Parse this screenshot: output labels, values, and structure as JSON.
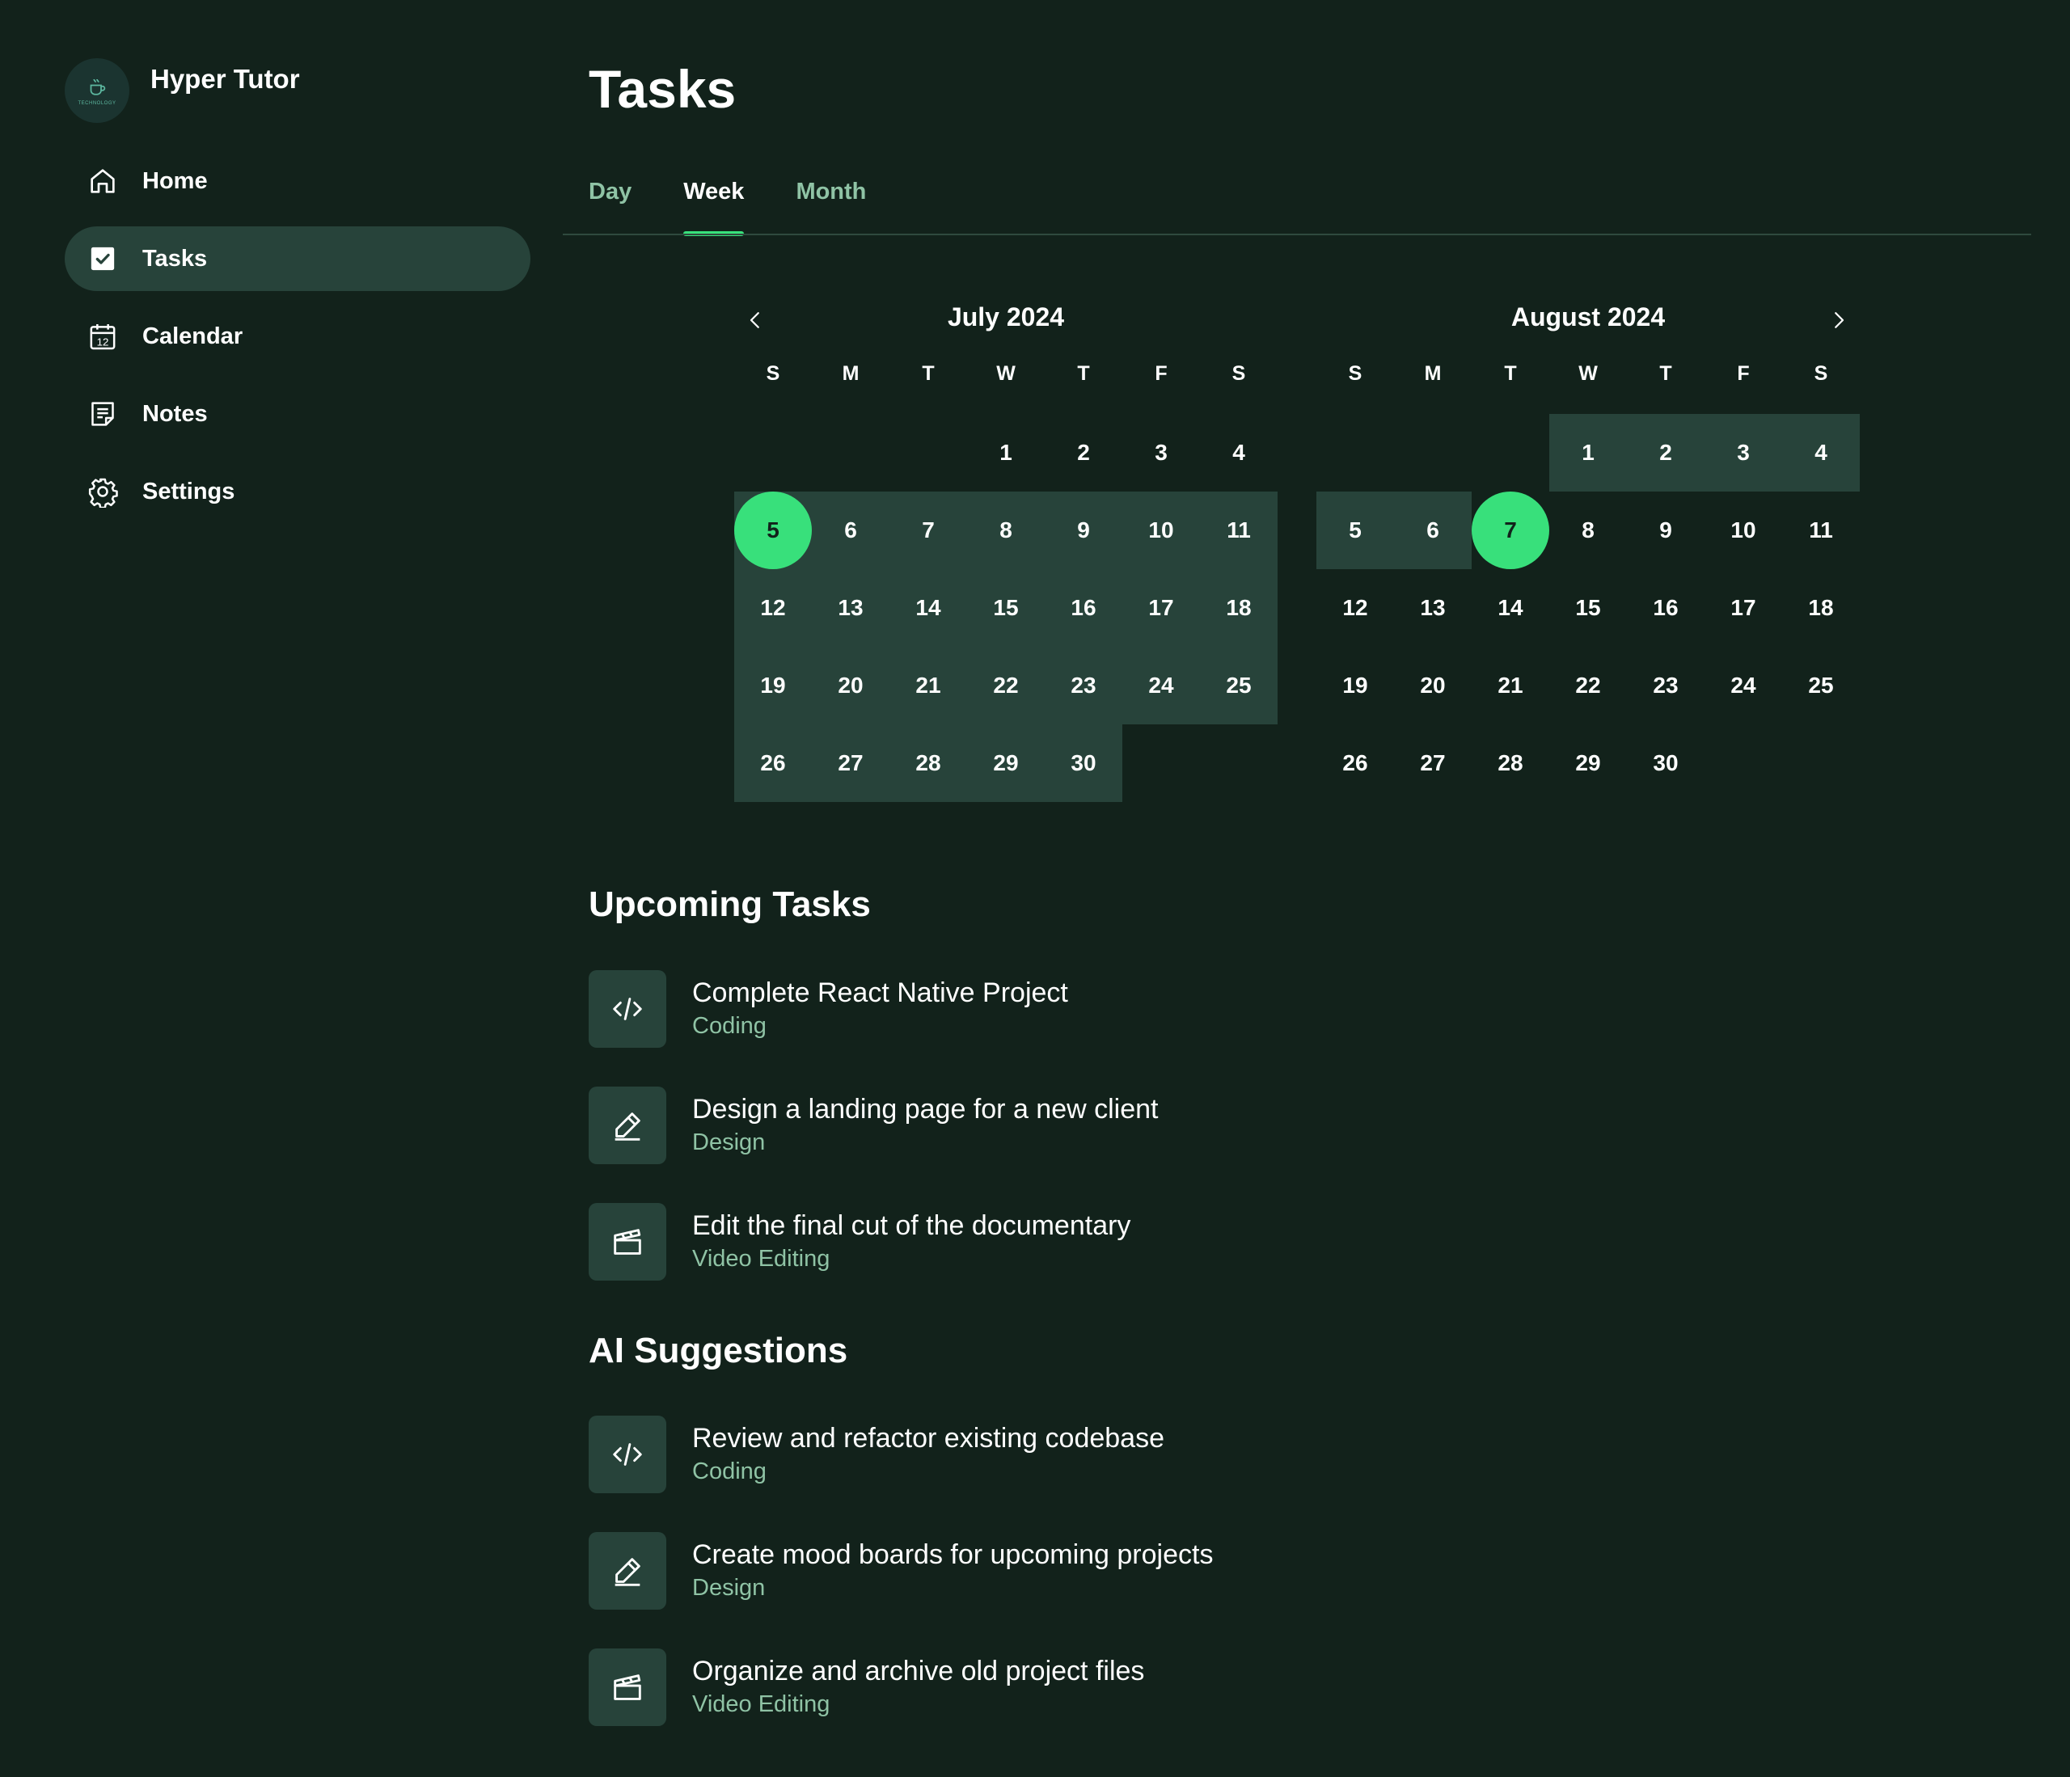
{
  "app": {
    "name": "Hyper Tutor",
    "logo_icon": "coffee-cup-logo",
    "logo_text": "TECHNOLOGY"
  },
  "sidebar": {
    "items": [
      {
        "label": "Home",
        "icon": "home-icon",
        "active": false
      },
      {
        "label": "Tasks",
        "icon": "checkbox-icon",
        "active": true
      },
      {
        "label": "Calendar",
        "icon": "calendar-icon",
        "active": false,
        "icon_text": "12"
      },
      {
        "label": "Notes",
        "icon": "notes-icon",
        "active": false
      },
      {
        "label": "Settings",
        "icon": "gear-icon",
        "active": false
      }
    ]
  },
  "page": {
    "title": "Tasks"
  },
  "tabs": [
    {
      "label": "Day",
      "active": false
    },
    {
      "label": "Week",
      "active": true
    },
    {
      "label": "Month",
      "active": false
    }
  ],
  "colors": {
    "background": "#12221b",
    "highlight": "#27433a",
    "accent": "#38e07b",
    "muted_text": "#8fc3a5"
  },
  "calendars": [
    {
      "title": "July 2024",
      "weekdays": [
        "S",
        "M",
        "T",
        "W",
        "T",
        "F",
        "S"
      ],
      "first_weekday": 3,
      "days_in_month": 30,
      "highlighted_range": [
        5,
        30
      ],
      "selected_day": 5
    },
    {
      "title": "August 2024",
      "weekdays": [
        "S",
        "M",
        "T",
        "W",
        "T",
        "F",
        "S"
      ],
      "first_weekday": 3,
      "days_in_month": 30,
      "highlighted_range": [
        1,
        6
      ],
      "selected_day": 7
    }
  ],
  "upcoming": {
    "title": "Upcoming Tasks",
    "items": [
      {
        "title": "Complete React Native Project",
        "category": "Coding",
        "icon": "code-icon"
      },
      {
        "title": "Design a landing page for a new client",
        "category": "Design",
        "icon": "pencil-icon"
      },
      {
        "title": "Edit the final cut of the documentary",
        "category": "Video Editing",
        "icon": "clapperboard-icon"
      }
    ]
  },
  "suggestions": {
    "title": "AI Suggestions",
    "items": [
      {
        "title": "Review and refactor existing codebase",
        "category": "Coding",
        "icon": "code-icon"
      },
      {
        "title": "Create mood boards for upcoming projects",
        "category": "Design",
        "icon": "pencil-icon"
      },
      {
        "title": "Organize and archive old project files",
        "category": "Video Editing",
        "icon": "clapperboard-icon"
      }
    ]
  }
}
